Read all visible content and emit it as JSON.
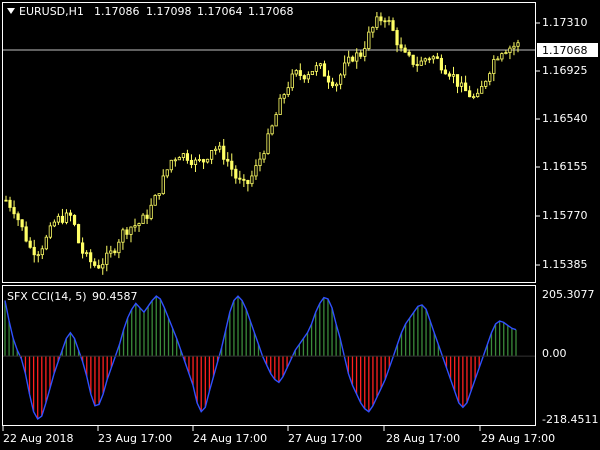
{
  "symbol_header": {
    "symbol": "EURUSD,H1",
    "open": "1.17086",
    "high": "1.17098",
    "low": "1.17064",
    "close": "1.17068"
  },
  "indicator_header": {
    "name": "SFX CCI(14, 5)",
    "value": "90.4587"
  },
  "price_axis": {
    "labels": [
      "1.17310",
      "1.16925",
      "1.16540",
      "1.16155",
      "1.15770",
      "1.15385"
    ],
    "current_price_label": "1.17068"
  },
  "indicator_axis": {
    "labels": [
      "205.3077",
      "0.00",
      "-218.4511"
    ]
  },
  "time_axis": {
    "labels": [
      "22 Aug 2018",
      "23 Aug 17:00",
      "24 Aug 17:00",
      "27 Aug 17:00",
      "28 Aug 17:00",
      "29 Aug 17:00"
    ]
  },
  "colors": {
    "background": "#000000",
    "candle": "#ffff66",
    "grid_border": "#ffffff",
    "cci_line": "#3050ff",
    "cci_positive": "#3a8a3a",
    "cci_negative": "#ff2020"
  },
  "chart_data": [
    {
      "type": "candlestick",
      "title": "EURUSD,H1",
      "ylim": [
        1.153,
        1.1736
      ],
      "close_path": [
        1.159,
        1.1583,
        1.1568,
        1.1553,
        1.1552,
        1.1562,
        1.1575,
        1.1577,
        1.1578,
        1.1553,
        1.1545,
        1.154,
        1.1545,
        1.1552,
        1.1565,
        1.157,
        1.1572,
        1.1578,
        1.159,
        1.1605,
        1.162,
        1.1625,
        1.1623,
        1.1618,
        1.162,
        1.163,
        1.1627,
        1.1618,
        1.1605,
        1.16,
        1.161,
        1.1625,
        1.164,
        1.166,
        1.1675,
        1.1685,
        1.1684,
        1.1688,
        1.169,
        1.1682,
        1.1678,
        1.169,
        1.1698,
        1.17,
        1.1715,
        1.1725,
        1.1728,
        1.1715,
        1.17,
        1.1695,
        1.1692,
        1.1698,
        1.1697,
        1.169,
        1.1685,
        1.1675,
        1.167,
        1.1665,
        1.168,
        1.1695,
        1.1703,
        1.1705,
        1.1707
      ],
      "last_close": 1.17068
    },
    {
      "type": "bar",
      "title": "SFX CCI(14, 5)",
      "ylim": [
        -218.4511,
        205.3077
      ],
      "values": [
        190,
        120,
        60,
        20,
        -10,
        -60,
        -130,
        -190,
        -215,
        -205,
        -160,
        -110,
        -60,
        -20,
        20,
        60,
        80,
        60,
        20,
        -20,
        -70,
        -130,
        -170,
        -165,
        -130,
        -80,
        -40,
        0,
        40,
        90,
        130,
        160,
        180,
        165,
        150,
        170,
        190,
        205,
        195,
        165,
        130,
        95,
        60,
        20,
        -20,
        -60,
        -100,
        -160,
        -190,
        -175,
        -120,
        -70,
        -20,
        30,
        90,
        150,
        190,
        205,
        190,
        160,
        120,
        80,
        40,
        0,
        -30,
        -60,
        -80,
        -90,
        -70,
        -40,
        -10,
        20,
        40,
        60,
        80,
        110,
        150,
        180,
        200,
        195,
        165,
        110,
        60,
        0,
        -60,
        -100,
        -130,
        -160,
        -180,
        -190,
        -170,
        -140,
        -110,
        -80,
        -40,
        0,
        40,
        80,
        110,
        130,
        150,
        170,
        175,
        160,
        120,
        80,
        40,
        0,
        -40,
        -80,
        -120,
        -160,
        -175,
        -160,
        -120,
        -80,
        -40,
        0,
        40,
        80,
        110,
        120,
        115,
        105,
        95,
        90
      ]
    }
  ]
}
